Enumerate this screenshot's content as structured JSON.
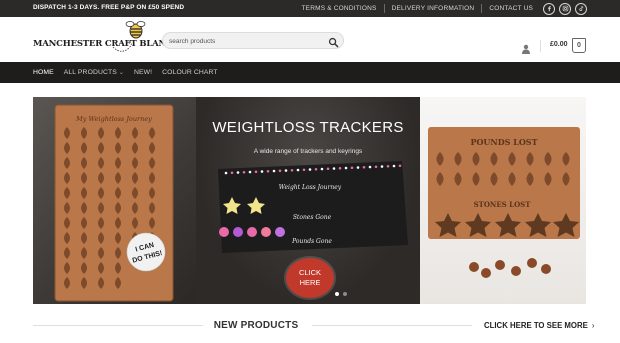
{
  "topbar": {
    "dispatch": "DISPATCH 1-3 DAYS. FREE P&P ON £50 SPEND",
    "links": [
      "TERMS & CONDITIONS",
      "DELIVERY INFORMATION",
      "CONTACT US"
    ],
    "social_icons": [
      "facebook-icon",
      "instagram-icon",
      "tiktok-icon"
    ]
  },
  "header": {
    "logo_text": "MANCHESTER CRAFT BLANKS",
    "search_placeholder": "search products",
    "cart_total": "£0.00",
    "cart_count": "0"
  },
  "nav": {
    "items": [
      {
        "label": "HOME",
        "active": true
      },
      {
        "label": "ALL PRODUCTS",
        "dropdown": true
      },
      {
        "label": "NEW!"
      },
      {
        "label": "COLOUR CHART"
      }
    ]
  },
  "banner": {
    "title": "WEIGHTLOSS TRACKERS",
    "subtitle": "A wide range of trackers and keyrings",
    "cta_line1": "CLICK",
    "cta_line2": "HERE",
    "left_board_title": "My Weightloss Journey",
    "left_badge_line1": "I CAN",
    "left_badge_line2": "DO THIS!",
    "mid_board_lines": [
      "Weight Loss Journey",
      "Stones Gone",
      "Pounds Gone"
    ],
    "right_board_title": "POUNDS LOST",
    "right_board_sub": "STONES LOST",
    "slide_count": 2,
    "active_slide": 0
  },
  "new_products": {
    "title": "NEW PRODUCTS",
    "more_link": "CLICK HERE TO SEE MORE"
  },
  "colors": {
    "topbar_bg": "#2b2a28",
    "nav_bg": "#1e1d1c",
    "cta": "#c0392b",
    "wood": "#b9774a"
  }
}
